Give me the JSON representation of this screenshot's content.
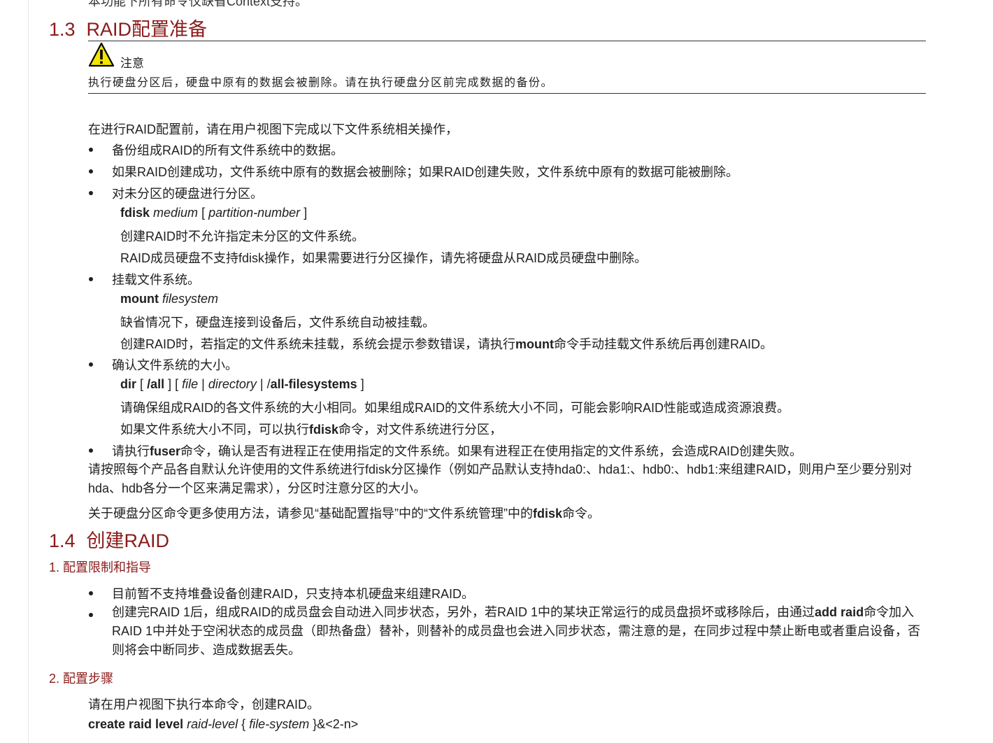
{
  "top_cut_text": "本功能下所有命令仅缺省Context支持。",
  "section_13": {
    "number": "1.3",
    "title": "RAID配置准备"
  },
  "notice": {
    "icon": "warning-triangle-icon",
    "label": "注意",
    "text": "执行硬盘分区后，硬盘中原有的数据会被删除。请在执行硬盘分区前完成数据的备份。"
  },
  "intro": "在进行RAID配置前，请在用户视图下完成以下文件系统相关操作，",
  "items": {
    "backup": "备份组成RAID的所有文件系统中的数据。",
    "raid_result": "如果RAID创建成功，文件系统中原有的数据会被删除；如果RAID创建失败，文件系统中原有的数据可能被删除。",
    "partition": "对未分区的硬盘进行分区。",
    "fdisk_cmd": {
      "keyword": "fdisk",
      "arg1": "medium",
      "open": "[",
      "arg2": "partition-number",
      "close": "]"
    },
    "partition_note1": "创建RAID时不允许指定未分区的文件系统。",
    "partition_note2": "RAID成员硬盘不支持fdisk操作，如果需要进行分区操作，请先将硬盘从RAID成员硬盘中删除。",
    "mount": "挂载文件系统。",
    "mount_cmd": {
      "keyword": "mount",
      "arg": "filesystem"
    },
    "mount_note1": "缺省情况下，硬盘连接到设备后，文件系统自动被挂载。",
    "mount_note2_pre": "创建RAID时，若指定的文件系统未挂载，系统会提示参数错误，请执行",
    "mount_note2_cmd": "mount",
    "mount_note2_post": "命令手动挂载文件系统后再创建RAID。",
    "size": "确认文件系统的大小。",
    "dir_cmd": {
      "keyword": "dir",
      "p1": "[",
      "all": "/all",
      "p2": "] [",
      "file": "file",
      "sep1": "|",
      "directory": "directory",
      "sep2": "| /",
      "allfs": "all-filesystems",
      "p3": "]"
    },
    "size_note1": "请确保组成RAID的各文件系统的大小相同。如果组成RAID的文件系统大小不同，可能会影响RAID性能或造成资源浪费。",
    "size_note2_pre": "如果文件系统大小不同，可以执行",
    "size_note2_cmd": "fdisk",
    "size_note2_post": "命令，对文件系统进行分区，",
    "fuser_pre": "请执行",
    "fuser_cmd": "fuser",
    "fuser_post": "命令，确认是否有进程正在使用指定的文件系统。如果有进程正在使用指定的文件系统，会造成RAID创建失败。"
  },
  "para_default": "请按照每个产品各自默认允许使用的文件系统进行fdisk分区操作（例如产品默认支持hda0:、hda1:、hdb0:、hdb1:来组建RAID，则用户至少要分别对hda、hdb各分一个区来满足需求），分区时注意分区的大小。",
  "para_ref_pre": "关于硬盘分区命令更多使用方法，请参见“基础配置指导”中的“文件系统管理”中的",
  "para_ref_cmd": "fdisk",
  "para_ref_post": "命令。",
  "section_14": {
    "number": "1.4",
    "title": "创建RAID"
  },
  "sub1": "1. 配置限制和指导",
  "limits": {
    "l1": "目前暂不支持堆叠设备创建RAID，只支持本机硬盘来组建RAID。",
    "l2_pre": "创建完RAID 1后，组成RAID的成员盘会自动进入同步状态，另外，若RAID 1中的某块正常运行的成员盘损坏或移除后，由通过",
    "l2_cmd": "add raid",
    "l2_post": "命令加入RAID 1中并处于空闲状态的成员盘（即热备盘）替补，则替补的成员盘也会进入同步状态，需注意的是，在同步过程中禁止断电或者重启设备，否则将会中断同步、造成数据丢失。"
  },
  "sub2": "2. 配置步骤",
  "step_intro": "请在用户视图下执行本命令，创建RAID。",
  "create_cmd": {
    "keyword": "create raid level",
    "arg": "raid-level",
    "open": "{",
    "fs": "file-system",
    "close": "}&<2-n>"
  }
}
